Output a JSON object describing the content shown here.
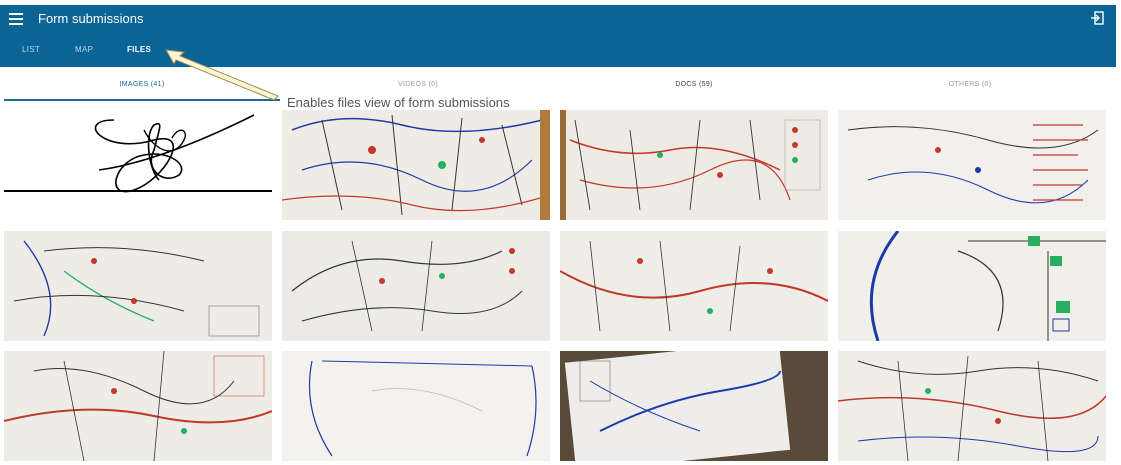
{
  "appbar": {
    "title": "Form submissions",
    "tabs": [
      "LIST",
      "MAP",
      "FILES"
    ],
    "active_tab": "FILES"
  },
  "subtabs": {
    "images": "IMAGES (41)",
    "videos": "VIDEOS (0)",
    "docs": "DOCS (59)",
    "others": "OTHERS (0)"
  },
  "annotation": "Enables files view of form submissions",
  "colors": {
    "appbar": "#0a6496",
    "accent": "#1b6b98",
    "paper": "#efece6"
  },
  "thumbnails": [
    {
      "kind": "signature"
    },
    {
      "kind": "map-sketch"
    },
    {
      "kind": "map-sketch"
    },
    {
      "kind": "map-sketch"
    },
    {
      "kind": "map-sketch"
    },
    {
      "kind": "map-sketch"
    },
    {
      "kind": "map-sketch"
    },
    {
      "kind": "map-sketch"
    },
    {
      "kind": "map-sketch"
    },
    {
      "kind": "map-sketch"
    },
    {
      "kind": "map-sketch"
    },
    {
      "kind": "map-sketch"
    }
  ]
}
